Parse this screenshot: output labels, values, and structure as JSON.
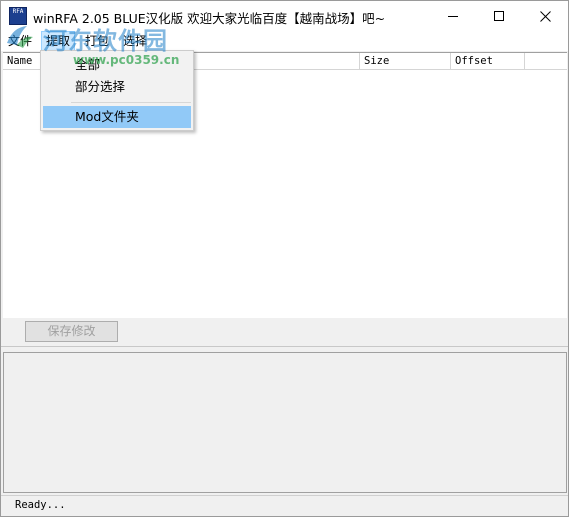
{
  "window": {
    "icon_text": [
      "RFA",
      ""
    ],
    "title": "winRFA 2.05 BLUE汉化版 欢迎大家光临百度【越南战场】吧~"
  },
  "menubar": {
    "items": [
      {
        "label": "文件"
      },
      {
        "label": "提取"
      },
      {
        "label": "打包"
      },
      {
        "label": "选择"
      }
    ]
  },
  "dropdown": {
    "items": [
      {
        "label": "全部"
      },
      {
        "label": "部分选择"
      },
      {
        "label": "Mod文件夹"
      }
    ]
  },
  "list": {
    "columns": [
      {
        "label": "Name"
      },
      {
        "label": "Size"
      },
      {
        "label": "Offset"
      },
      {
        "label": ""
      }
    ]
  },
  "toolbar": {
    "save_label": "保存修改"
  },
  "status": {
    "text": "Ready..."
  },
  "watermark": {
    "text": "河东软件园",
    "url": "www.pc0359.cn"
  },
  "colors": {
    "menu_active": "#cce8ff",
    "dropdown_highlight": "#91c9f7",
    "watermark_blue": "#1e7fc8",
    "watermark_green": "#2aa04a"
  }
}
